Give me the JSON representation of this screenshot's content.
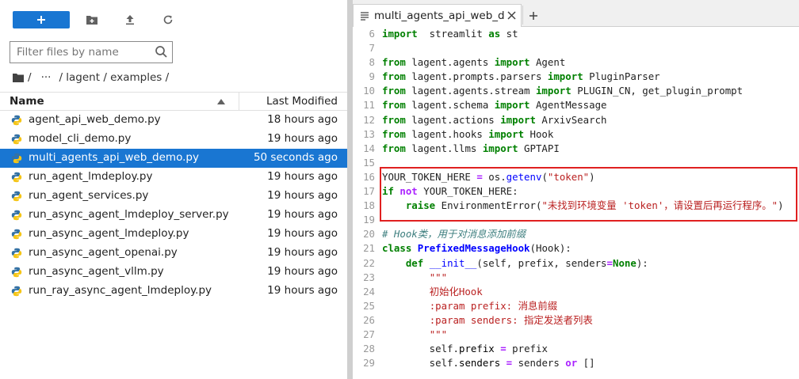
{
  "file_browser": {
    "filter_placeholder": "Filter files by name",
    "breadcrumb": [
      "/",
      "···",
      "/ lagent / examples /"
    ],
    "header": {
      "name": "Name",
      "last_modified": "Last Modified"
    },
    "files": [
      {
        "name": "agent_api_web_demo.py",
        "modified": "18 hours ago",
        "selected": false
      },
      {
        "name": "model_cli_demo.py",
        "modified": "19 hours ago",
        "selected": false
      },
      {
        "name": "multi_agents_api_web_demo.py",
        "modified": "50 seconds ago",
        "selected": true
      },
      {
        "name": "run_agent_lmdeploy.py",
        "modified": "19 hours ago",
        "selected": false
      },
      {
        "name": "run_agent_services.py",
        "modified": "19 hours ago",
        "selected": false
      },
      {
        "name": "run_async_agent_lmdeploy_server.py",
        "modified": "19 hours ago",
        "selected": false
      },
      {
        "name": "run_async_agent_lmdeploy.py",
        "modified": "19 hours ago",
        "selected": false
      },
      {
        "name": "run_async_agent_openai.py",
        "modified": "19 hours ago",
        "selected": false
      },
      {
        "name": "run_async_agent_vllm.py",
        "modified": "19 hours ago",
        "selected": false
      },
      {
        "name": "run_ray_async_agent_lmdeploy.py",
        "modified": "19 hours ago",
        "selected": false
      }
    ]
  },
  "editor": {
    "tab_label": "multi_agents_api_web_demo.py",
    "lines": [
      {
        "n": "6",
        "segs": [
          [
            "kw",
            "import"
          ],
          [
            "",
            "  streamlit "
          ],
          [
            "kw",
            "as"
          ],
          [
            "",
            " st"
          ]
        ]
      },
      {
        "n": "7",
        "segs": []
      },
      {
        "n": "8",
        "segs": [
          [
            "kw",
            "from"
          ],
          [
            "",
            " lagent.agents "
          ],
          [
            "kw",
            "import"
          ],
          [
            "",
            " Agent"
          ]
        ]
      },
      {
        "n": "9",
        "segs": [
          [
            "kw",
            "from"
          ],
          [
            "",
            " lagent.prompts.parsers "
          ],
          [
            "kw",
            "import"
          ],
          [
            "",
            " PluginParser"
          ]
        ]
      },
      {
        "n": "10",
        "segs": [
          [
            "kw",
            "from"
          ],
          [
            "",
            " lagent.agents.stream "
          ],
          [
            "kw",
            "import"
          ],
          [
            "",
            " PLUGIN_CN, get_plugin_prompt"
          ]
        ]
      },
      {
        "n": "11",
        "segs": [
          [
            "kw",
            "from"
          ],
          [
            "",
            " lagent.schema "
          ],
          [
            "kw",
            "import"
          ],
          [
            "",
            " AgentMessage"
          ]
        ]
      },
      {
        "n": "12",
        "segs": [
          [
            "kw",
            "from"
          ],
          [
            "",
            " lagent.actions "
          ],
          [
            "kw",
            "import"
          ],
          [
            "",
            " ArxivSearch"
          ]
        ]
      },
      {
        "n": "13",
        "segs": [
          [
            "kw",
            "from"
          ],
          [
            "",
            " lagent.hooks "
          ],
          [
            "kw",
            "import"
          ],
          [
            "",
            " Hook"
          ]
        ]
      },
      {
        "n": "14",
        "segs": [
          [
            "kw",
            "from"
          ],
          [
            "",
            " lagent.llms "
          ],
          [
            "kw",
            "import"
          ],
          [
            "",
            " GPTAPI"
          ]
        ]
      },
      {
        "n": "15",
        "segs": []
      },
      {
        "n": "16",
        "segs": [
          [
            "",
            "YOUR_TOKEN_HERE "
          ],
          [
            "op",
            "="
          ],
          [
            "",
            " os."
          ],
          [
            "fn",
            "getenv"
          ],
          [
            "",
            "("
          ],
          [
            "str",
            "\"token\""
          ],
          [
            "",
            ")"
          ]
        ]
      },
      {
        "n": "17",
        "segs": [
          [
            "kw",
            "if"
          ],
          [
            "",
            " "
          ],
          [
            "op",
            "not"
          ],
          [
            "",
            " YOUR_TOKEN_HERE:"
          ]
        ]
      },
      {
        "n": "18",
        "segs": [
          [
            "",
            "    "
          ],
          [
            "kw",
            "raise"
          ],
          [
            "",
            " EnvironmentError("
          ],
          [
            "str",
            "\"未找到环境变量 'token'，请设置后再运行程序。\""
          ],
          [
            "",
            ")"
          ]
        ]
      },
      {
        "n": "19",
        "segs": []
      },
      {
        "n": "20",
        "segs": [
          [
            "cm",
            "# Hook类，用于对消息添加前缀"
          ]
        ]
      },
      {
        "n": "21",
        "segs": [
          [
            "kw",
            "class"
          ],
          [
            "",
            " "
          ],
          [
            "cls",
            "PrefixedMessageHook"
          ],
          [
            "",
            "(Hook):"
          ]
        ]
      },
      {
        "n": "22",
        "segs": [
          [
            "",
            "    "
          ],
          [
            "kw",
            "def"
          ],
          [
            "",
            " "
          ],
          [
            "fn",
            "__init__"
          ],
          [
            "",
            "(self, prefix, senders"
          ],
          [
            "op",
            "="
          ],
          [
            "kw",
            "None"
          ],
          [
            "",
            "):"
          ]
        ]
      },
      {
        "n": "23",
        "segs": [
          [
            "",
            "        "
          ],
          [
            "str",
            "\"\"\""
          ]
        ]
      },
      {
        "n": "24",
        "segs": [
          [
            "",
            "        "
          ],
          [
            "str",
            "初始化Hook"
          ]
        ]
      },
      {
        "n": "25",
        "segs": [
          [
            "",
            "        "
          ],
          [
            "str",
            ":param prefix: 消息前缀"
          ]
        ]
      },
      {
        "n": "26",
        "segs": [
          [
            "",
            "        "
          ],
          [
            "str",
            ":param senders: 指定发送者列表"
          ]
        ]
      },
      {
        "n": "27",
        "segs": [
          [
            "",
            "        "
          ],
          [
            "str",
            "\"\"\""
          ]
        ]
      },
      {
        "n": "28",
        "segs": [
          [
            "",
            "        self."
          ],
          [
            "attr",
            "prefix"
          ],
          [
            "",
            " "
          ],
          [
            "op",
            "="
          ],
          [
            "",
            " prefix"
          ]
        ]
      },
      {
        "n": "29",
        "segs": [
          [
            "",
            "        self."
          ],
          [
            "attr",
            "senders"
          ],
          [
            "",
            " "
          ],
          [
            "op",
            "="
          ],
          [
            "",
            " senders "
          ],
          [
            "op",
            "or"
          ],
          [
            "",
            " []"
          ]
        ]
      }
    ]
  },
  "colors": {
    "accent": "#1976d2",
    "highlight_border": "#e02020"
  }
}
